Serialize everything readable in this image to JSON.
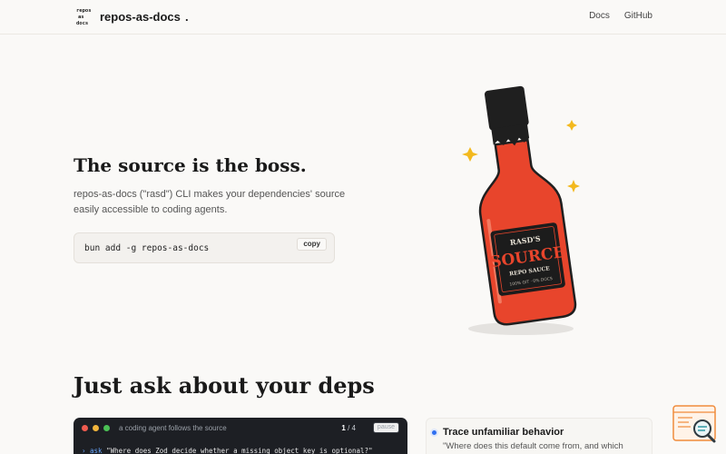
{
  "header": {
    "logo_lines": [
      "repos",
      "as",
      "docs"
    ],
    "brand": "repos-as-docs",
    "brand_suffix": ".",
    "nav": {
      "docs": "Docs",
      "github": "GitHub"
    }
  },
  "hero": {
    "title": "The source is the boss.",
    "subtitle": "repos-as-docs (\"rasd\") CLI makes your dependencies' source easily accessible to coding agents.",
    "install_command": "bun add -g repos-as-docs",
    "copy_label": "copy",
    "bottle": {
      "label_top": "RASD'S",
      "label_main": "SOURCE",
      "label_sub": "REPO SAUCE",
      "label_small": "100% GIT · 0% DOCS",
      "colors": {
        "bottle": "#e8452c",
        "cap": "#1f1f1f",
        "label": "#1c1c1c",
        "label_text": "#e8452c",
        "sparkle": "#f3b91e"
      }
    }
  },
  "section": {
    "title": "Just ask about your deps",
    "terminal": {
      "caption": "a coding agent follows the source",
      "counter_current": "1",
      "counter_sep": " / ",
      "counter_total": "4",
      "pause_label": "pause",
      "prompt": "› ask",
      "line": "\"Where does Zod decide whether a missing object key is optional?\""
    },
    "feature": {
      "title": "Trace unfamiliar behavior",
      "quote": "\"Where does this default come from, and which"
    }
  },
  "colors": {
    "accent": "#2f6ff0",
    "background": "#faf9f7",
    "terminal_bg": "#1d1f24"
  }
}
